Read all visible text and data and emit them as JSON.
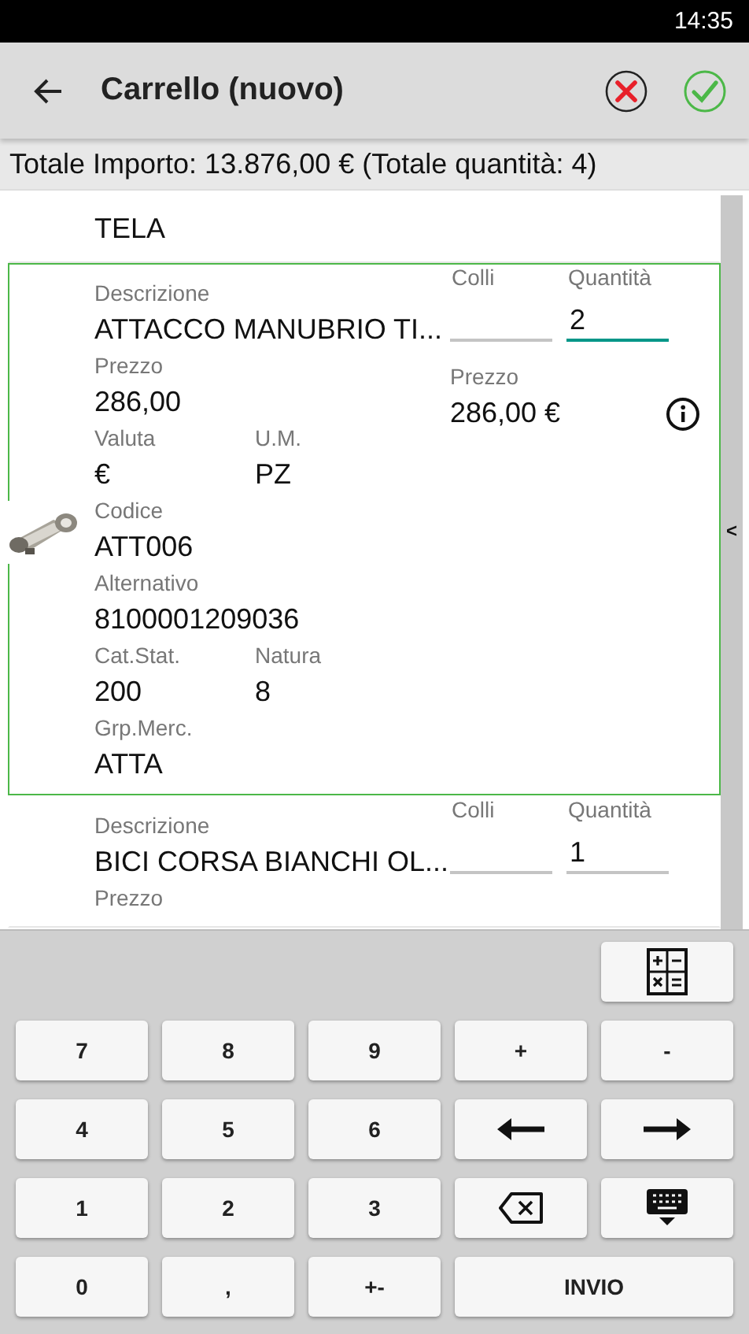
{
  "status_bar": {
    "time": "14:35"
  },
  "toolbar": {
    "title": "Carrello (nuovo)"
  },
  "summary": "Totale Importo: 13.876,00 € (Totale quantità: 4)",
  "items": [
    {
      "selected": false,
      "rows": [
        [
          {
            "value": "TELA"
          }
        ]
      ]
    },
    {
      "selected": true,
      "image": true,
      "info": true,
      "rows": [
        [
          {
            "label": "Descrizione",
            "value": "ATTACCO MANUBRIO TI..."
          }
        ],
        [
          {
            "label": "Prezzo",
            "value": "286,00"
          }
        ],
        [
          {
            "label": "Valuta",
            "value": "€"
          },
          {
            "label": "U.M.",
            "value": "PZ"
          }
        ],
        [
          {
            "label": "Codice",
            "value": "ATT006"
          }
        ],
        [
          {
            "label": "Alternativo",
            "value": "8100001209036"
          }
        ],
        [
          {
            "label": "Cat.Stat.",
            "value": "200"
          },
          {
            "label": "Natura",
            "value": "8"
          }
        ],
        [
          {
            "label": "Grp.Merc.",
            "value": "ATTA"
          }
        ]
      ],
      "colli_label": "Colli",
      "quantity_label": "Quantità",
      "quantity": "2",
      "quantity_focused": true,
      "price_label": "Prezzo",
      "price": "286,00 €"
    },
    {
      "selected": false,
      "rows": [
        [
          {
            "label": "Descrizione",
            "value": "BICI CORSA BIANCHI OL..."
          }
        ],
        [
          {
            "label": "Prezzo"
          }
        ]
      ],
      "colli_label": "Colli",
      "quantity_label": "Quantità",
      "quantity": "1",
      "quantity_focused": false
    }
  ],
  "scrollbar": {
    "handle": "<"
  },
  "keys": [
    {
      "kind": "calculator"
    },
    {
      "kind": "text",
      "label": "7"
    },
    {
      "kind": "text",
      "label": "8"
    },
    {
      "kind": "text",
      "label": "9"
    },
    {
      "kind": "text",
      "label": "+"
    },
    {
      "kind": "text",
      "label": "-"
    },
    {
      "kind": "text",
      "label": "4"
    },
    {
      "kind": "text",
      "label": "5"
    },
    {
      "kind": "text",
      "label": "6"
    },
    {
      "kind": "left"
    },
    {
      "kind": "right"
    },
    {
      "kind": "text",
      "label": "1"
    },
    {
      "kind": "text",
      "label": "2"
    },
    {
      "kind": "text",
      "label": "3"
    },
    {
      "kind": "backspace"
    },
    {
      "kind": "hide"
    },
    {
      "kind": "text",
      "label": "0"
    },
    {
      "kind": "text",
      "label": ","
    },
    {
      "kind": "text",
      "label": "+-"
    },
    {
      "kind": "wide",
      "label": "INVIO"
    }
  ]
}
